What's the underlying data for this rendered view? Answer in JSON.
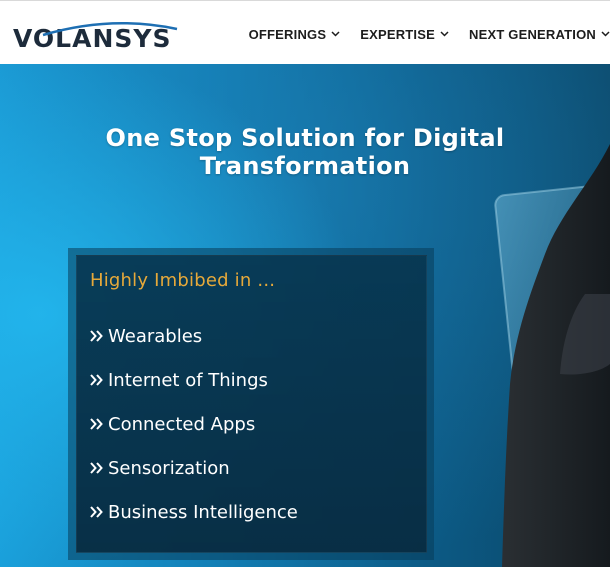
{
  "brand": {
    "name": "VOLANSYS",
    "icon": "volansys-logo"
  },
  "nav": {
    "items": [
      {
        "label": "OFFERINGS",
        "icon": "chevron-down-icon"
      },
      {
        "label": "EXPERTISE",
        "icon": "chevron-down-icon"
      },
      {
        "label": "NEXT GENERATION",
        "icon": "chevron-down-icon"
      }
    ]
  },
  "hero": {
    "title": "One Stop Solution for Digital Transformation",
    "panel": {
      "heading": "Highly Imbibed in ...",
      "bullet_icon": "double-chevron-right-icon",
      "items": [
        "Wearables",
        "Internet of Things",
        "Connected Apps",
        "Sensorization",
        "Business Intelligence"
      ]
    }
  },
  "colors": {
    "logo_text": "#1d2b3b",
    "logo_accent": "#1e6fb3",
    "nav_text": "#1d1d1d",
    "hero_blue": "#1a9fda",
    "panel_bg": "#073650",
    "panel_heading": "#e6a93a"
  }
}
